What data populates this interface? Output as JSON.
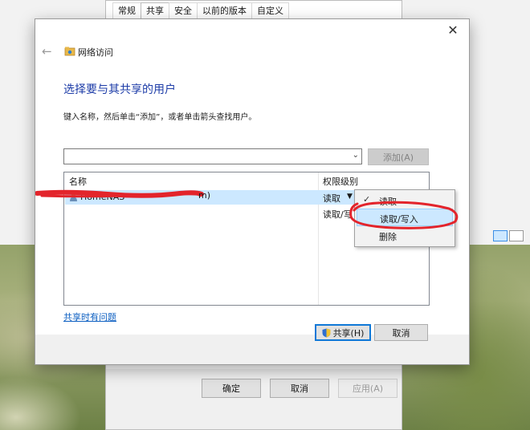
{
  "props_window": {
    "tabs": [
      "常规",
      "共享",
      "安全",
      "以前的版本",
      "自定义"
    ],
    "active_tab": "共享",
    "buttons": {
      "ok": "确定",
      "cancel": "取消",
      "apply": "应用(A)"
    }
  },
  "dialog": {
    "breadcrumb": "网络访问",
    "heading": "选择要与其共享的用户",
    "instruction": "键入名称，然后单击“添加”，或者单击箭头查找用户。",
    "name_input": {
      "value": "",
      "placeholder": ""
    },
    "add_button": "添加(A)",
    "columns": {
      "name": "名称",
      "permission": "权限级别"
    },
    "rows": [
      {
        "name": "HomeNAS",
        "permission": "读取",
        "selected": true
      },
      {
        "name": "",
        "permission": "读取/写",
        "tail": "m)",
        "selected": false
      }
    ],
    "trouble_link": "共享时有问题",
    "share_button": "共享(H)",
    "cancel_button": "取消"
  },
  "context_menu": {
    "items": [
      {
        "label": "读取",
        "checked": true
      },
      {
        "label": "读取/写入",
        "highlighted": true
      },
      {
        "label": "删除"
      }
    ]
  },
  "colors": {
    "heading": "#1e3da8",
    "link": "#0b5ec1",
    "selection": "#cce8ff",
    "annotation": "#e3242b"
  }
}
